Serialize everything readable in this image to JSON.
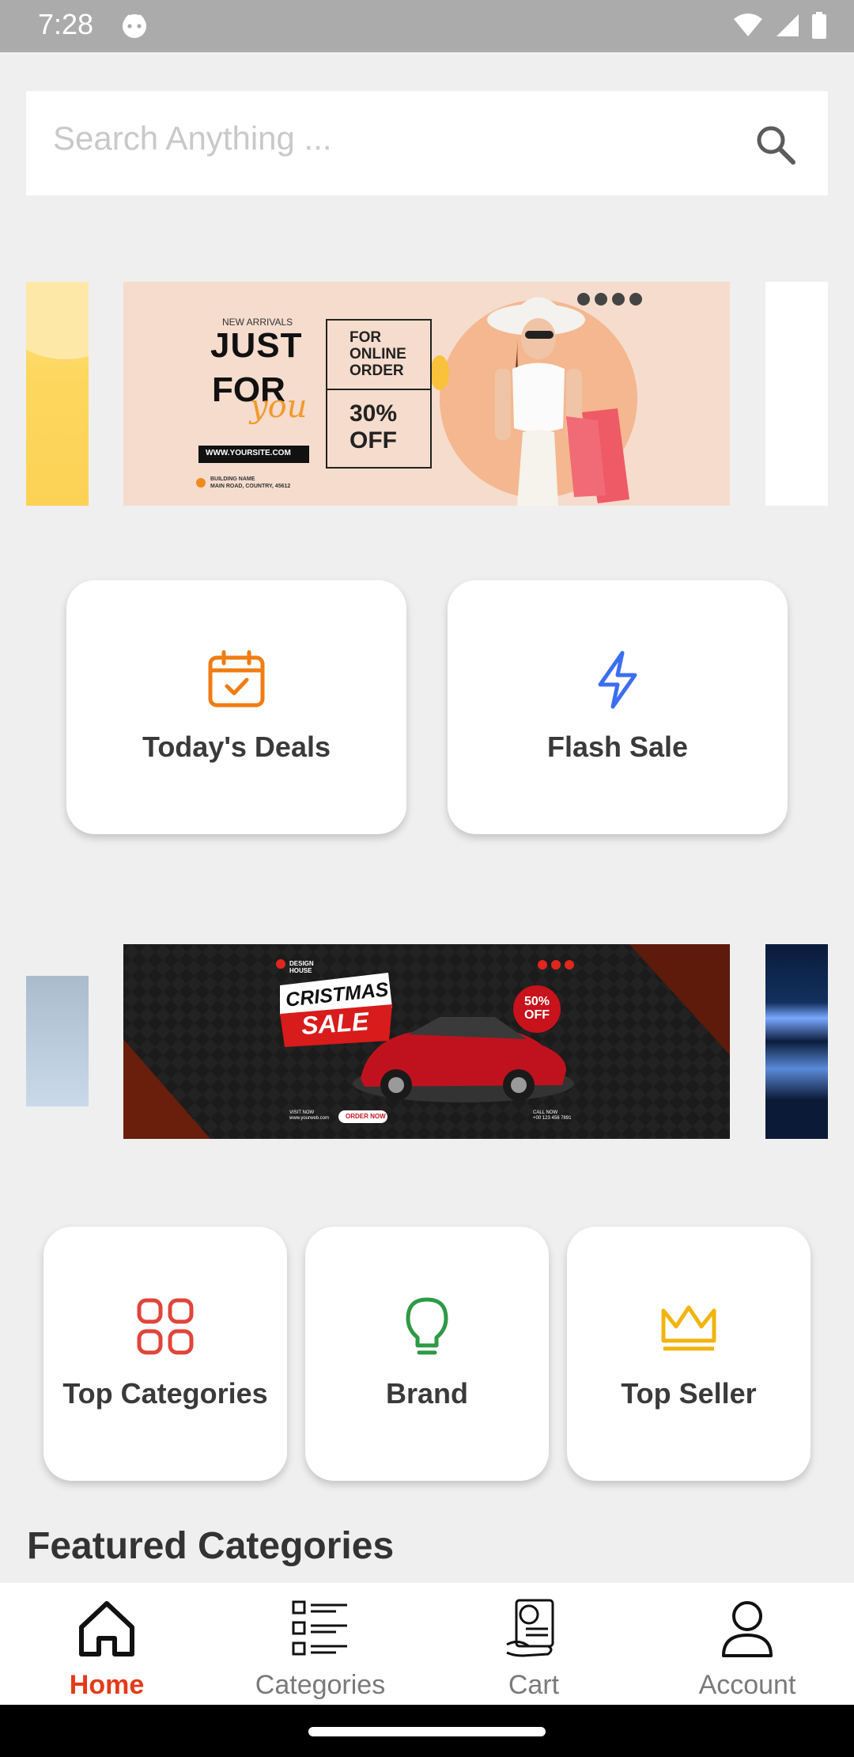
{
  "status": {
    "time": "7:28"
  },
  "search": {
    "placeholder": "Search Anything ..."
  },
  "banner1": {
    "new_arrivals": "NEW ARRIVALS",
    "just": "JUST",
    "for": "FOR",
    "you": "you",
    "for_online_order": [
      "FOR",
      "ONLINE",
      "ORDER"
    ],
    "discount": [
      "30%",
      "OFF"
    ],
    "website": "WWW.YOURSITE.COM",
    "address": [
      "BUILDING NAME",
      "MAIN ROAD, COUNTRY, 45612"
    ]
  },
  "quick_cards": [
    {
      "label": "Today's Deals",
      "icon": "calendar-check-icon",
      "color": "#f07c12"
    },
    {
      "label": "Flash Sale",
      "icon": "lightning-icon",
      "color": "#3b6ef0"
    }
  ],
  "banner2": {
    "brand": "DESIGN HOUSE",
    "title_top": "CRISTMAS",
    "title_bottom": "SALE",
    "badge": [
      "50%",
      "OFF"
    ],
    "visit_label": "VISIT NOW",
    "visit_url": "www.yourweb.com",
    "order_button": "ORDER NOW",
    "call_label": "CALL NOW",
    "phone": "+00 123 456 7891"
  },
  "category_cards": [
    {
      "label": "Top Categories",
      "icon": "categories-grid-icon",
      "color": "#e0453a"
    },
    {
      "label": "Brand",
      "icon": "lightbulb-icon",
      "color": "#2d9a45"
    },
    {
      "label": "Top Seller",
      "icon": "crown-icon",
      "color": "#f2b40c"
    }
  ],
  "featured_title": "Featured Categories",
  "nav": {
    "items": [
      {
        "label": "Home",
        "icon": "home-icon",
        "active": true
      },
      {
        "label": "Categories",
        "icon": "list-icon",
        "active": false
      },
      {
        "label": "Cart",
        "icon": "cart-icon",
        "active": false
      },
      {
        "label": "Account",
        "icon": "account-icon",
        "active": false
      }
    ],
    "active_color": "#e53918"
  }
}
